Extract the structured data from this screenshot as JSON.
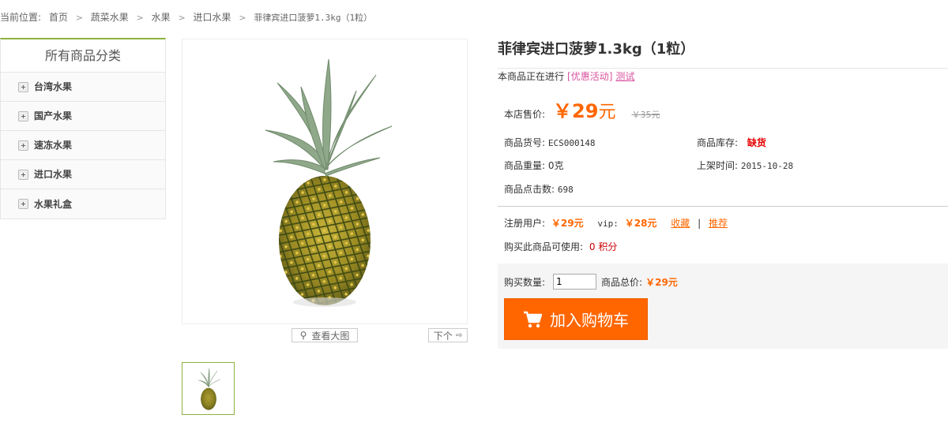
{
  "breadcrumb": {
    "prefix": "当前位置:",
    "items": [
      "首页",
      "蔬菜水果",
      "水果",
      "进口水果"
    ],
    "current": "菲律宾进口菠萝1.3kg（1粒）"
  },
  "sidebar": {
    "title": "所有商品分类",
    "items": [
      {
        "label": "台湾水果"
      },
      {
        "label": "国产水果"
      },
      {
        "label": "速冻水果"
      },
      {
        "label": "进口水果"
      },
      {
        "label": "水果礼盒"
      }
    ]
  },
  "gallery": {
    "zoom_label": "查看大图",
    "next_label": "下个"
  },
  "product": {
    "title": "菲律宾进口菠萝1.3kg（1粒）",
    "promo_text": "本商品正在进行",
    "promo_tag": "[优惠活动]",
    "promo_link": "测试",
    "price_label": "本店售价:",
    "price_symbol": "￥",
    "price_value": "29",
    "price_unit": "元",
    "market_price": "￥35元",
    "sku_label": "商品货号:",
    "sku_value": "ECS000148",
    "stock_label": "商品库存:",
    "stock_value": "缺货",
    "weight_label": "商品重量:",
    "weight_value": "0克",
    "date_label": "上架时间:",
    "date_value": "2015-10-28",
    "clicks_label": "商品点击数:",
    "clicks_value": "698"
  },
  "member": {
    "reg_label": "注册用户:",
    "reg_price": "￥29元",
    "vip_label": "vip:",
    "vip_price": "￥28元",
    "favorite": "收藏",
    "separator": "|",
    "recommend": "推荐",
    "points_label": "购买此商品可使用:",
    "points_value": "0 积分"
  },
  "buy": {
    "qty_label": "购买数量:",
    "qty_value": "1",
    "total_label": "商品总价:",
    "total_value": "￥29元",
    "cart_label": "加入购物车"
  },
  "colors": {
    "accent_green": "#8cb33f",
    "price_orange": "#ff6600",
    "stock_red": "#e60000",
    "promo_pink": "#d9539f"
  }
}
